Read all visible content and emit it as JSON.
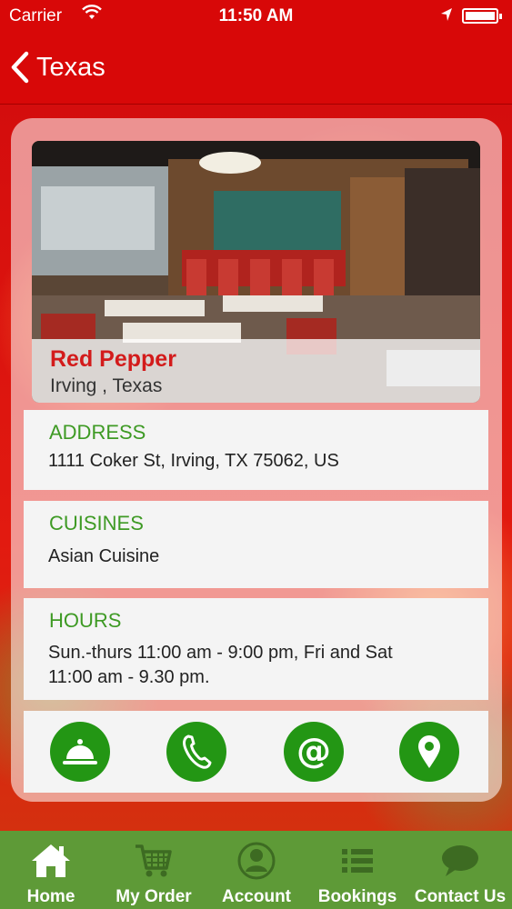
{
  "status_bar": {
    "carrier": "Carrier",
    "time": "11:50 AM"
  },
  "nav": {
    "back_label": "Texas"
  },
  "restaurant": {
    "name": "Red Pepper",
    "location": "Irving , Texas"
  },
  "sections": {
    "address": {
      "title": "ADDRESS",
      "value": "1111 Coker St, Irving, TX 75062, US"
    },
    "cuisines": {
      "title": "CUISINES",
      "value": "Asian Cuisine"
    },
    "hours": {
      "title": "HOURS",
      "line1": "Sun.-thurs 11:00 am - 9:00 pm, Fri and Sat",
      "line2": "11:00 am - 9.30 pm."
    }
  },
  "actions": [
    {
      "icon": "service-bell-icon"
    },
    {
      "icon": "phone-icon"
    },
    {
      "icon": "at-email-icon"
    },
    {
      "icon": "map-pin-icon"
    }
  ],
  "tabs": [
    {
      "label": "Home",
      "icon": "home-icon"
    },
    {
      "label": "My Order",
      "icon": "cart-icon"
    },
    {
      "label": "Account",
      "icon": "account-icon"
    },
    {
      "label": "Bookings",
      "icon": "list-icon"
    },
    {
      "label": "Contact Us",
      "icon": "chat-bubble-icon"
    }
  ],
  "colors": {
    "header_red": "#d80808",
    "accent_green": "#3e9a24",
    "button_green": "#239614",
    "tabbar_green": "#5e9a37",
    "name_red": "#d31b1b"
  }
}
